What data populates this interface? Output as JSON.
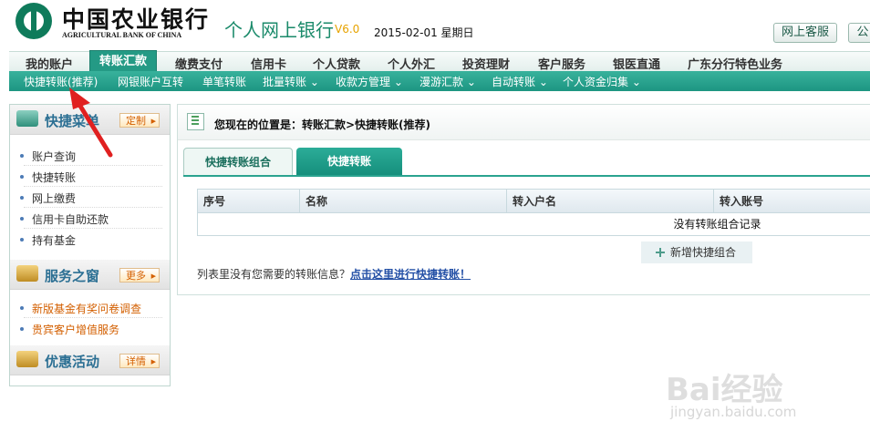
{
  "header": {
    "bank_name_cn": "中国农业银行",
    "bank_name_en": "AGRICULTURAL BANK OF CHINA",
    "site_title": "个人网上银行",
    "version": "V6.0",
    "date": "2015-02-01 星期日",
    "service_button": "网上客服",
    "second_button": "公"
  },
  "nav": {
    "items": [
      "我的账户",
      "转账汇款",
      "缴费支付",
      "信用卡",
      "个人贷款",
      "个人外汇",
      "投资理财",
      "客户服务",
      "银医直通",
      "广东分行特色业务"
    ],
    "active_index": 1
  },
  "subnav": {
    "items": [
      "快捷转账(推荐)",
      "网银账户互转",
      "单笔转账",
      "批量转账 ⌄",
      "收款方管理 ⌄",
      "漫游汇款 ⌄",
      "自动转账 ⌄",
      "个人资金归集 ⌄"
    ]
  },
  "sidebar": {
    "quick_menu": {
      "title": "快捷菜单",
      "button": "定制",
      "links": [
        "账户查询",
        "快捷转账",
        "网上缴费",
        "信用卡自助还款",
        "持有基金"
      ]
    },
    "service_window": {
      "title": "服务之窗",
      "button": "更多",
      "links": [
        "新版基金有奖问卷调查",
        "贵宾客户增值服务"
      ]
    },
    "promotions": {
      "title": "优惠活动",
      "button": "详情"
    }
  },
  "main": {
    "breadcrumb": "您现在的位置是：转账汇款>快捷转账(推荐)",
    "tabs": [
      "快捷转账组合",
      "快捷转账"
    ],
    "table": {
      "headers": [
        "序号",
        "名称",
        "转入户名",
        "转入账号"
      ],
      "empty_message": "没有转账组合记录"
    },
    "add_button": "新增快捷组合",
    "footer_note": "列表里没有您需要的转账信息？",
    "footer_link": "点击这里进行快捷转账！"
  },
  "watermark": {
    "brand": "Bai经验",
    "domain": "jingyan.baidu.com"
  },
  "colors": {
    "brand_green": "#1a8a6a",
    "nav_teal": "#249a85",
    "link_blue": "#2450a6",
    "arrow_red": "#e02020"
  }
}
